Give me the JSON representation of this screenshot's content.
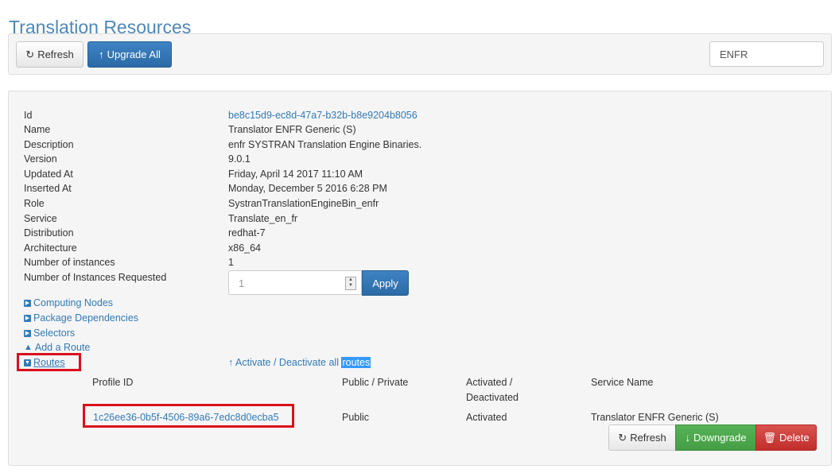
{
  "page": {
    "title": "Translation Resources"
  },
  "toolbar": {
    "refresh_label": "Refresh",
    "upgrade_all_label": "Upgrade All",
    "search_value": "ENFR"
  },
  "details": {
    "fields": [
      {
        "label": "Id",
        "value": "be8c15d9-ec8d-47a7-b32b-b8e9204b8056"
      },
      {
        "label": "Name",
        "value": "Translator ENFR Generic (S)"
      },
      {
        "label": "Description",
        "value": "enfr SYSTRAN Translation Engine Binaries."
      },
      {
        "label": "Version",
        "value": "9.0.1"
      },
      {
        "label": "Updated At",
        "value": "Friday, April 14 2017 11:10 AM"
      },
      {
        "label": "Inserted At",
        "value": "Monday, December 5 2016 6:28 PM"
      },
      {
        "label": "Role",
        "value": "SystranTranslationEngineBin_enfr"
      },
      {
        "label": "Service",
        "value": "Translate_en_fr"
      },
      {
        "label": "Distribution",
        "value": "redhat-7"
      },
      {
        "label": "Architecture",
        "value": "x86_64"
      },
      {
        "label": "Number of instances",
        "value": "1"
      }
    ],
    "instances_requested_label": "Number of Instances Requested",
    "instances_requested_value": "1",
    "apply_label": "Apply"
  },
  "sections": {
    "computing_nodes": "Computing Nodes",
    "package_dependencies": "Package Dependencies",
    "selectors": "Selectors",
    "add_route": "Add a Route",
    "routes": "Routes",
    "activate_prefix": "Activate / Deactivate all",
    "activate_highlight": "routes"
  },
  "routes_table": {
    "headers": {
      "profile_id": "Profile ID",
      "public_private": "Public / Private",
      "activated_line1": "Activated /",
      "activated_line2": "Deactivated",
      "service_name": "Service Name"
    },
    "rows": [
      {
        "profile_id": "1c26ee36-0b5f-4506-89a6-7edc8d0ecba5",
        "public_private": "Public",
        "status": "Activated",
        "service_name": "Translator ENFR Generic (S)"
      }
    ],
    "actions": {
      "refresh_label": "Refresh",
      "downgrade_label": "Downgrade",
      "delete_label": "Delete"
    }
  },
  "colors": {
    "title": "#4d87b8",
    "link": "#337ab7",
    "primary": "#2b6aa6",
    "success": "#449d44",
    "danger": "#c9302c",
    "highlight": "#d9101c"
  },
  "icons": {
    "refresh": "refresh-icon",
    "upgrade": "arrow-up-icon",
    "expand": "expand-icon",
    "collapse": "collapse-icon",
    "road": "road-icon",
    "downgrade": "arrow-down-icon",
    "delete": "trash-icon"
  }
}
